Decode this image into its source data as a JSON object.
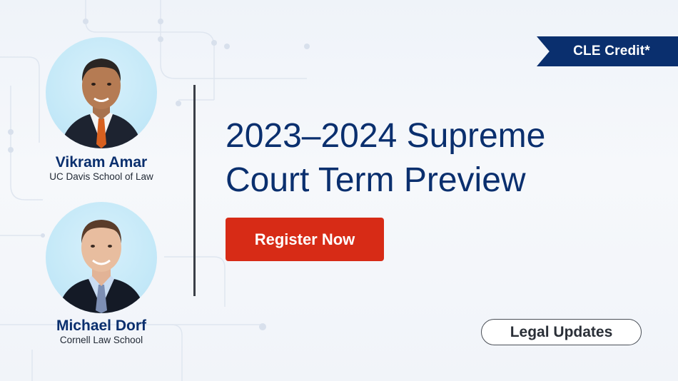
{
  "badge": {
    "label": "CLE Credit*"
  },
  "speakers": [
    {
      "name": "Vikram Amar",
      "school": "UC Davis School of Law"
    },
    {
      "name": "Michael Dorf",
      "school": "Cornell Law School"
    }
  ],
  "headline": {
    "line1": "2023–2024 Supreme",
    "line2": "Court Term Preview"
  },
  "cta": {
    "label": "Register Now"
  },
  "category": {
    "label": "Legal Updates"
  },
  "colors": {
    "navy": "#0a2f6e",
    "cta_red": "#d72b16",
    "avatar_bg": "#c5e9f8"
  }
}
